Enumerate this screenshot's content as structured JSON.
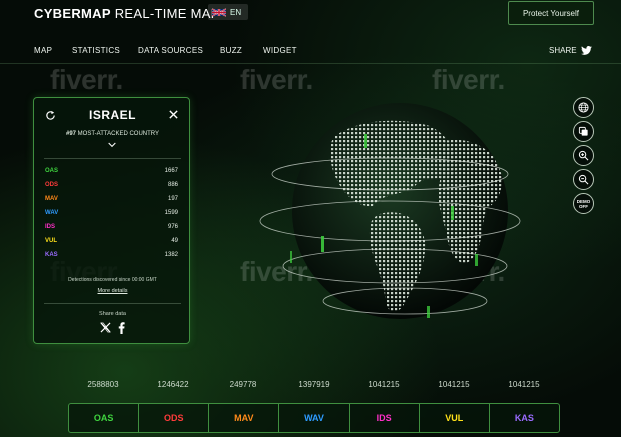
{
  "header": {
    "brand_bold": "CYBERMAP",
    "brand_rest": "REAL-TIME MAP",
    "language": "EN",
    "protect_label": "Protect Yourself"
  },
  "nav": {
    "items": [
      "MAP",
      "STATISTICS",
      "DATA SOURCES",
      "BUZZ",
      "WIDGET"
    ],
    "share_label": "SHARE"
  },
  "watermark": "fiverr.",
  "panel": {
    "country": "ISRAEL",
    "rank": "#97",
    "rank_text": "MOST-ATTACKED COUNTRY",
    "stats": [
      {
        "name": "OAS",
        "value": "1667",
        "color": "#3fd43f"
      },
      {
        "name": "ODS",
        "value": "886",
        "color": "#ff3b3b"
      },
      {
        "name": "MAV",
        "value": "197",
        "color": "#ff8a1a"
      },
      {
        "name": "WAV",
        "value": "1599",
        "color": "#2e9bff"
      },
      {
        "name": "IDS",
        "value": "976",
        "color": "#ff2fc8"
      },
      {
        "name": "VUL",
        "value": "49",
        "color": "#ffe11a"
      },
      {
        "name": "KAS",
        "value": "1382",
        "color": "#9a6bff"
      }
    ],
    "detection_text": "Detections discovered since 00:00 GMT",
    "more_details": "More details",
    "share_data": "Share data"
  },
  "tools": {
    "demo_line1": "DEMO",
    "demo_line2": "OFF"
  },
  "bottom": [
    {
      "name": "OAS",
      "total": "2588803",
      "color": "#3fd43f"
    },
    {
      "name": "ODS",
      "total": "1246422",
      "color": "#ff3b3b"
    },
    {
      "name": "MAV",
      "total": "249778",
      "color": "#ff8a1a"
    },
    {
      "name": "WAV",
      "total": "1397919",
      "color": "#2e9bff"
    },
    {
      "name": "IDS",
      "total": "1041215",
      "color": "#ff2fc8"
    },
    {
      "name": "VUL",
      "total": "1041215",
      "color": "#ffe11a"
    },
    {
      "name": "KAS",
      "total": "1041215",
      "color": "#9a6bff"
    }
  ]
}
